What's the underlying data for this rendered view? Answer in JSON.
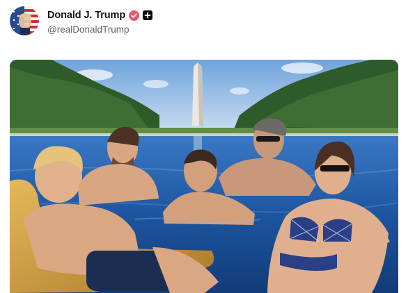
{
  "post": {
    "author": {
      "display_name": "Donald J. Trump",
      "handle": "@realDonaldTrump",
      "verified": true,
      "avatar_icon": "flag-portrait-avatar",
      "verified_icon": "verified-badge-icon",
      "follow_icon": "plus-icon"
    },
    "media": {
      "type": "image",
      "description_icon": "pool-photo-image"
    }
  },
  "colors": {
    "verified_badge": "#e8586d",
    "name_text": "#111418",
    "handle_text": "#5b6470",
    "background": "#ffffff"
  }
}
